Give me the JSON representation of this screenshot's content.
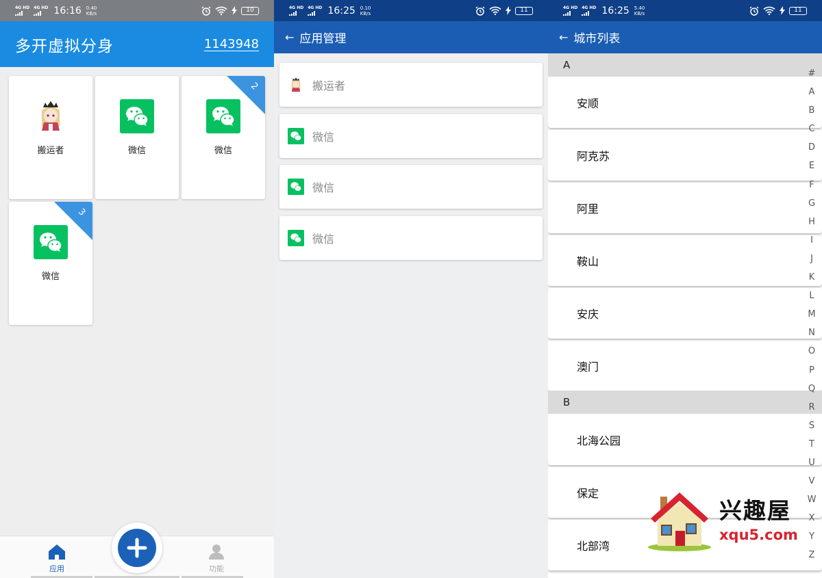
{
  "status_bar_1": {
    "network": "4G HD",
    "network2": "4G HD",
    "time": "16:16",
    "speed": "0.40",
    "speed_unit": "KB/s",
    "battery": "10"
  },
  "status_bar_2": {
    "network": "4G HD",
    "network2": "4G HD",
    "time": "16:25",
    "speed": "0.10",
    "speed_unit": "KB/s",
    "battery": "11"
  },
  "status_bar_3": {
    "network": "4G HD",
    "network2": "4G HD",
    "time": "16:25",
    "speed": "5.40",
    "speed_unit": "KB/s",
    "battery": "11"
  },
  "home": {
    "title": "多开虚拟分身",
    "code": "1143948",
    "apps": [
      {
        "label": "搬运者",
        "icon": "anime-avatar-icon",
        "badge": ""
      },
      {
        "label": "微信",
        "icon": "wechat-icon",
        "badge": ""
      },
      {
        "label": "微信",
        "icon": "wechat-icon",
        "badge": "2"
      },
      {
        "label": "微信",
        "icon": "wechat-icon",
        "badge": "3"
      }
    ],
    "nav": {
      "apps_label": "应用",
      "features_label": "功能"
    }
  },
  "manage": {
    "title": "应用管理",
    "items": [
      {
        "label": "搬运者",
        "icon": "anime-avatar-icon"
      },
      {
        "label": "微信",
        "icon": "wechat-icon"
      },
      {
        "label": "微信",
        "icon": "wechat-icon"
      },
      {
        "label": "微信",
        "icon": "wechat-icon"
      }
    ]
  },
  "cities": {
    "title": "城市列表",
    "sections": [
      {
        "letter": "A",
        "items": [
          "安顺",
          "阿克苏",
          "阿里",
          "鞍山",
          "安庆",
          "澳门"
        ]
      },
      {
        "letter": "B",
        "items": [
          "北海公园",
          "保定",
          "北部湾"
        ]
      }
    ],
    "index": [
      "#",
      "A",
      "B",
      "C",
      "D",
      "E",
      "F",
      "G",
      "H",
      "I",
      "J",
      "K",
      "L",
      "M",
      "N",
      "O",
      "P",
      "Q",
      "R",
      "S",
      "T",
      "U",
      "V",
      "W",
      "X",
      "Y",
      "Z"
    ]
  },
  "watermark": {
    "name": "兴趣屋",
    "url": "xqu5.com"
  },
  "colors": {
    "home_blue": "#1a8be1",
    "nav_blue": "#1a5db3",
    "status_dark": "#0f3f86",
    "wechat_green": "#07c160",
    "ribbon_blue": "#3c94e0"
  }
}
